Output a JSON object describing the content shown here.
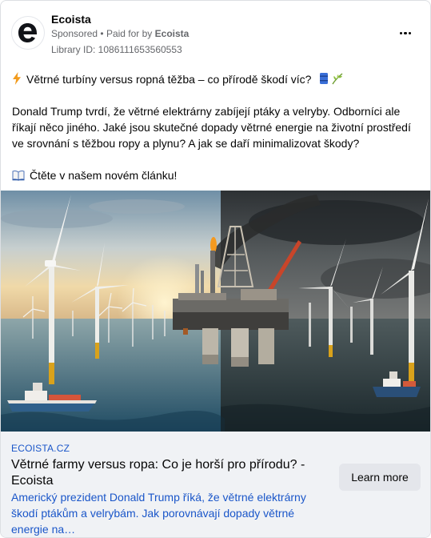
{
  "advertiser": {
    "name": "Ecoista",
    "sponsored_label": "Sponsored",
    "separator": "•",
    "paid_for_label": "Paid for by",
    "paid_for_name": "Ecoista",
    "library_id": "Library ID: 1086111653560553"
  },
  "post": {
    "headline_line": "Větrné turbíny versus ropná těžba – co přírodě škodí víc?",
    "paragraph": "Donald Trump tvrdí, že větrné elektrárny zabíjejí ptáky a velryby. Odborníci ale říkají něco jiného. Jaké jsou skutečné dopady větrné energie na životní prostředí ve srovnání s těžbou ropy a plynu? A jak se daří minimalizovat škody?",
    "cta_line": "Čtěte v našem novém článku!"
  },
  "link": {
    "domain": "ECOISTA.CZ",
    "title": "Větrné farmy versus ropa: Co je horší pro přírodu? - Ecoista",
    "description": "Americký prezident Donald Trump říká, že větrné elektrárny škodí ptákům a velrybám. Jak porovnávají dopady větrné energie na…",
    "button_label": "Learn more"
  },
  "colors": {
    "link_blue": "#1a56c9",
    "secondary_text": "#65676b",
    "footer_bg": "#f0f2f5",
    "button_bg": "#e4e6eb"
  },
  "icons": {
    "bolt": "lightning-bolt-icon",
    "can": "oil-barrel-icon",
    "leaf": "leaf-icon",
    "book": "open-book-icon",
    "more": "more-options-icon"
  }
}
